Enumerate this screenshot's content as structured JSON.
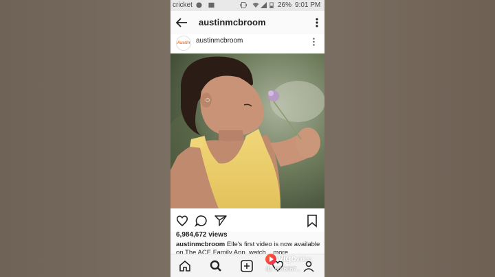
{
  "status_bar": {
    "carrier": "cricket",
    "battery": "26%",
    "time": "9:01 PM"
  },
  "app_bar": {
    "title": "austinmcbroom"
  },
  "post": {
    "avatar_text": "Austin",
    "username": "austinmcbroom",
    "views": "6,984,672 views",
    "caption_user": "austinmcbroom",
    "caption_text": " Elle's first video is now available on The ACE Family App, watch... more"
  },
  "watermark": {
    "brand": "Vigo",
    "brand_suffix": "video",
    "id_text": "ID: 5076367..."
  },
  "colors": {
    "accent": "#e8245a",
    "avatar_text": "#e8762b"
  }
}
